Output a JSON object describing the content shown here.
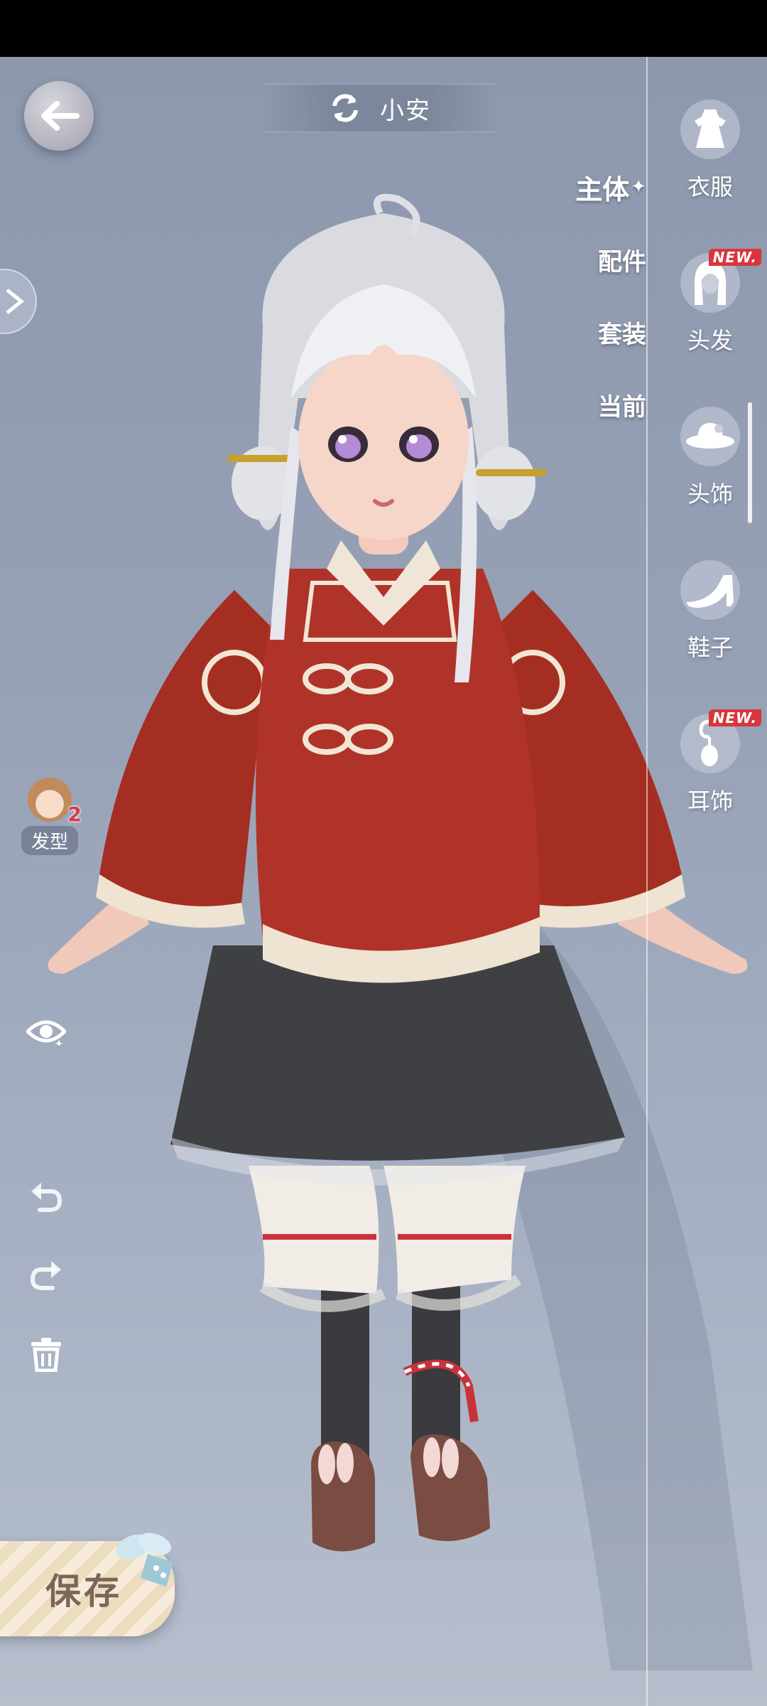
{
  "header": {
    "character_name": "小安"
  },
  "categories": [
    {
      "label": "主体",
      "active": true
    },
    {
      "label": "配件",
      "active": false
    },
    {
      "label": "套装",
      "active": false
    },
    {
      "label": "当前",
      "active": false
    }
  ],
  "right_panel": {
    "items": [
      {
        "label": "衣服",
        "icon": "dress-icon",
        "new": false
      },
      {
        "label": "头发",
        "icon": "hair-icon",
        "new": true
      },
      {
        "label": "头饰",
        "icon": "hat-icon",
        "new": false
      },
      {
        "label": "鞋子",
        "icon": "shoe-icon",
        "new": false
      },
      {
        "label": "耳饰",
        "icon": "earring-icon",
        "new": true
      }
    ],
    "new_tag": "NEW."
  },
  "hair_badge": {
    "label": "发型",
    "count": "2"
  },
  "save_button": {
    "label": "保存"
  },
  "colors": {
    "background": "#96a1b6",
    "new_tag": "#d8363d",
    "save_bg": "#f6ecd9",
    "save_text": "#7b6657"
  }
}
